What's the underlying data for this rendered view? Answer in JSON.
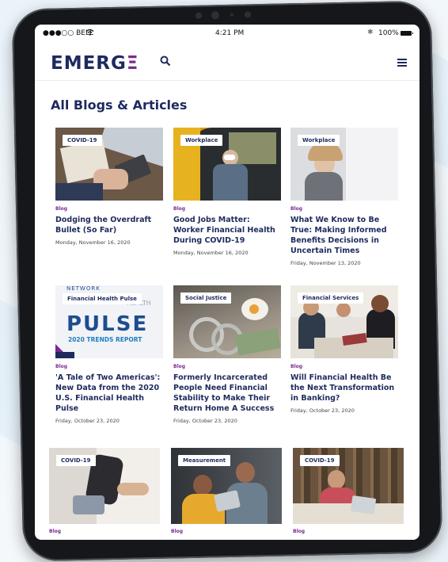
{
  "status_bar": {
    "carrier": "●●●○○ BELL",
    "time": "4:21 PM",
    "battery": "100%"
  },
  "site": {
    "logo_main": "EMERG",
    "logo_accent": "Ξ"
  },
  "icons": {
    "search": "search-icon",
    "menu": "hamburger-menu-icon",
    "bluetooth": "bluetooth-icon",
    "wifi": "wifi-icon",
    "battery": "battery-icon"
  },
  "colors": {
    "brand_navy": "#1e2a5e",
    "brand_purple": "#7b2a90"
  },
  "page": {
    "title": "All Blogs & Articles"
  },
  "cards": [
    {
      "tag": "COVID-19",
      "type": "Blog",
      "title": "Dodging the Overdraft Bullet (So Far)",
      "date": "Monday, November 16, 2020"
    },
    {
      "tag": "Workplace",
      "type": "Blog",
      "title": "Good Jobs Matter: Worker Financial Health During COVID-19",
      "date": "Monday, November 16, 2020"
    },
    {
      "tag": "Workplace",
      "type": "Blog",
      "title": "What We Know to Be True: Making Informed Benefits Decisions in Uncertain Times",
      "date": "Friday, November 13, 2020"
    },
    {
      "tag": "Financial Health Pulse",
      "type": "Blog",
      "title": "'A Tale of Two Americas': New Data from the 2020 U.S. Financial Health Pulse",
      "date": "Friday, October 23, 2020",
      "image_text": {
        "network": "NETWORK",
        "health": "HEALTH",
        "pulse": "PULSE",
        "report": "2020 TRENDS REPORT"
      }
    },
    {
      "tag": "Social Justice",
      "type": "Blog",
      "title": "Formerly Incarcerated People Need Financial Stability to Make Their Return Home A Success",
      "date": "Friday, October 23, 2020"
    },
    {
      "tag": "Financial Services",
      "type": "Blog",
      "title": "Will Financial Health Be the Next Transformation in Banking?",
      "date": "Friday, October 23, 2020"
    },
    {
      "tag": "COVID-19",
      "type": "Blog"
    },
    {
      "tag": "Measurement",
      "type": "Blog"
    },
    {
      "tag": "COVID-19",
      "type": "Blog"
    }
  ]
}
